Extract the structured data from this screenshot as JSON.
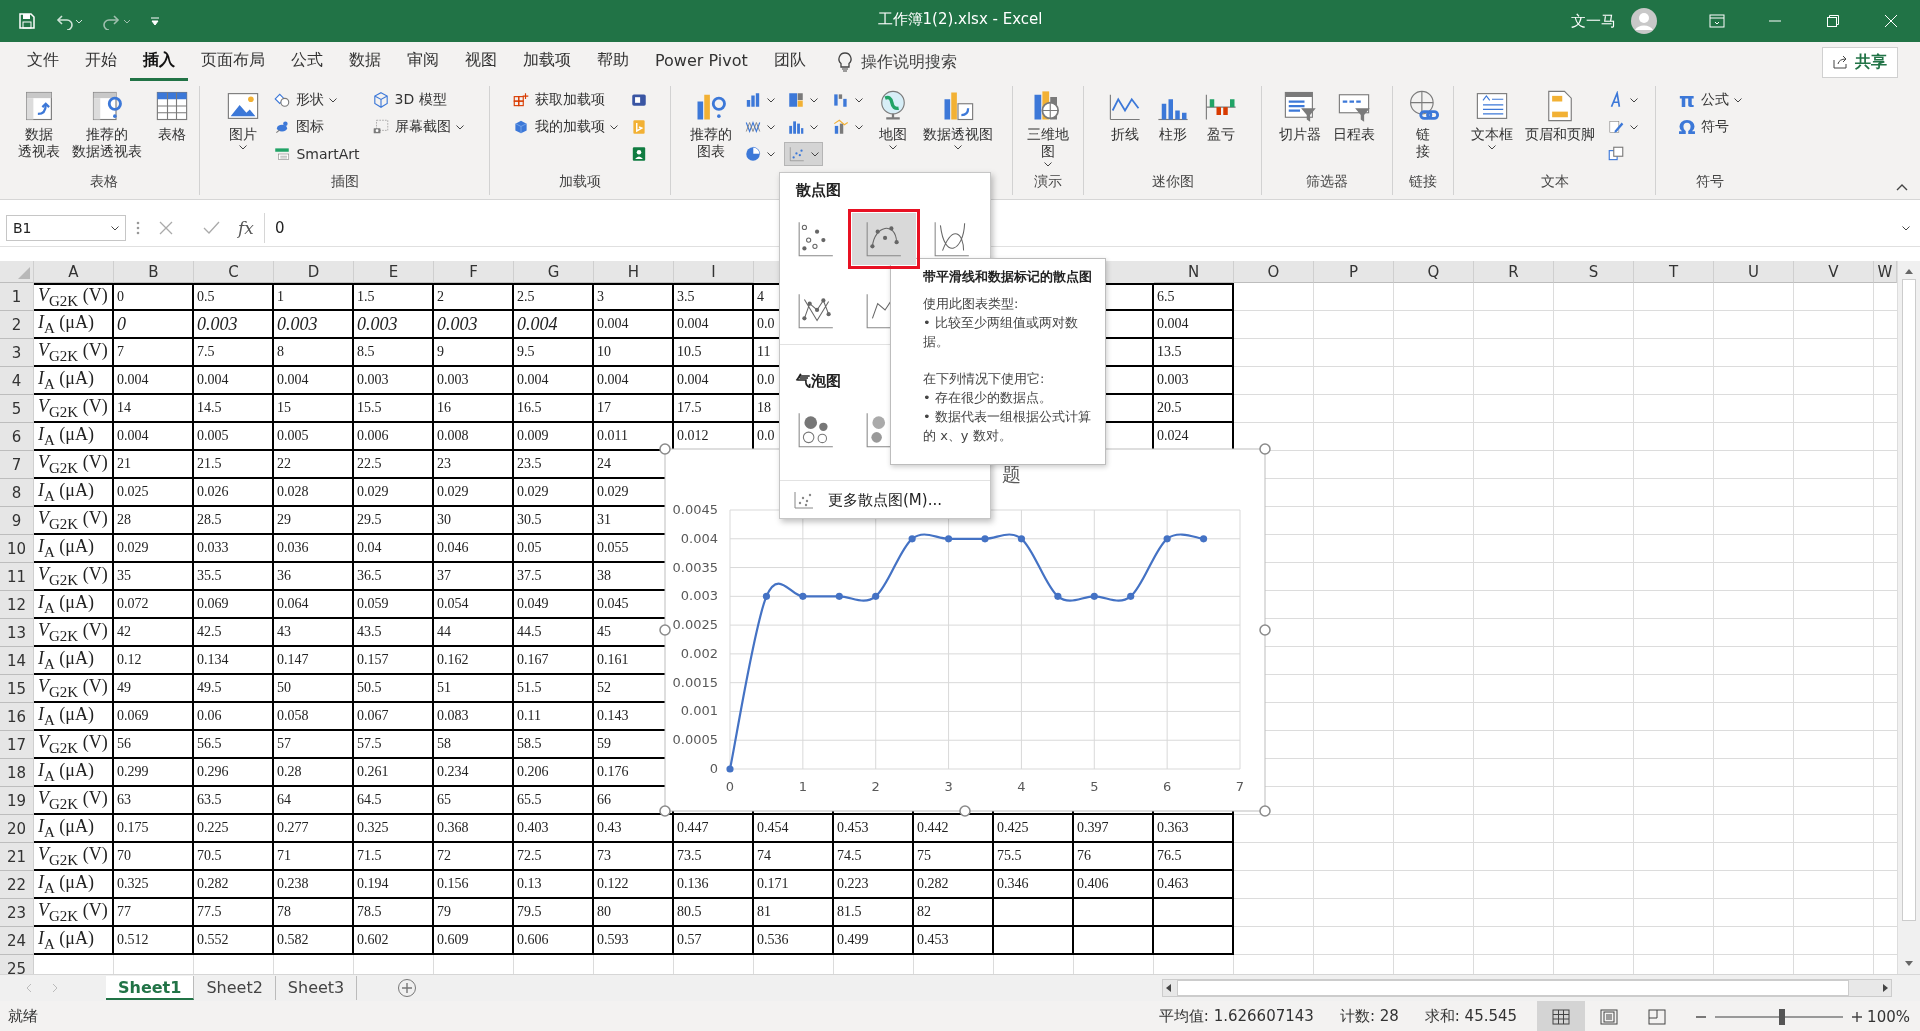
{
  "window": {
    "title": "工作簿1(2).xlsx - Excel",
    "user": "文一马"
  },
  "menu_tabs": [
    {
      "label": "文件",
      "selected": false
    },
    {
      "label": "开始",
      "selected": false
    },
    {
      "label": "插入",
      "selected": true
    },
    {
      "label": "页面布局",
      "selected": false
    },
    {
      "label": "公式",
      "selected": false
    },
    {
      "label": "数据",
      "selected": false
    },
    {
      "label": "审阅",
      "selected": false
    },
    {
      "label": "视图",
      "selected": false
    },
    {
      "label": "加载项",
      "selected": false
    },
    {
      "label": "帮助",
      "selected": false
    },
    {
      "label": "Power Pivot",
      "selected": false
    },
    {
      "label": "团队",
      "selected": false
    }
  ],
  "tell_me": {
    "placeholder": "操作说明搜索"
  },
  "share": "共享",
  "ribbon": [
    {
      "label": "表格",
      "items": [
        {
          "kind": "large",
          "lines": [
            "数据",
            "透视表"
          ]
        },
        {
          "kind": "large",
          "lines": [
            "推荐的",
            "数据透视表"
          ]
        },
        {
          "kind": "large",
          "lines": [
            "表格"
          ]
        }
      ]
    },
    {
      "label": "插图",
      "items": [
        {
          "kind": "large",
          "lines": [
            "图片"
          ],
          "dropdown": true
        },
        {
          "kind": "stack",
          "rows": [
            {
              "label": "形状",
              "dropdown": true
            },
            {
              "label": "图标"
            },
            {
              "label": "SmartArt"
            }
          ]
        },
        {
          "kind": "stack",
          "rows": [
            {
              "label": "3D 模型"
            },
            {
              "label": "屏幕截图",
              "dropdown": true
            }
          ]
        }
      ]
    },
    {
      "label": "加载项",
      "items": [
        {
          "kind": "stack",
          "rows": [
            {
              "label": "获取加载项"
            },
            {
              "label": "我的加载项",
              "dropdown": true
            }
          ]
        },
        {
          "kind": "stack",
          "rows": [
            {
              "dropdown": false
            },
            {
              "dropdown": false
            },
            {
              "dropdown": false
            }
          ]
        }
      ]
    },
    {
      "items": [
        {
          "kind": "large",
          "lines": [
            "推荐的",
            "图表"
          ]
        },
        {
          "kind": "stack",
          "rows": [
            {
              "dropdown": true,
              "pressed": false
            },
            {
              "dropdown": true,
              "pressed": false
            },
            {
              "dropdown": true,
              "pressed": false
            }
          ]
        },
        {
          "kind": "stack",
          "rows": [
            {
              "dropdown": true,
              "pressed": false
            },
            {
              "dropdown": true,
              "pressed": false
            },
            {
              "dropdown": true,
              "pressed": true
            }
          ]
        },
        {
          "kind": "stack",
          "rows": [
            {
              "dropdown": true,
              "pressed": false
            },
            {
              "dropdown": true,
              "pressed": false
            }
          ]
        },
        {
          "kind": "large",
          "lines": [
            "地图"
          ],
          "dropdown": true
        },
        {
          "kind": "large",
          "lines": [
            "数据透视图"
          ],
          "dropdown": true
        }
      ]
    },
    {
      "label": "演示",
      "items": [
        {
          "kind": "large",
          "lines": [
            "三维地",
            "图"
          ],
          "dropdown": true
        }
      ]
    },
    {
      "label": "迷你图",
      "items": [
        {
          "kind": "large",
          "lines": [
            "折线"
          ]
        },
        {
          "kind": "large",
          "lines": [
            "柱形"
          ]
        },
        {
          "kind": "large",
          "lines": [
            "盈亏"
          ]
        }
      ]
    },
    {
      "label": "筛选器",
      "items": [
        {
          "kind": "large",
          "lines": [
            "切片器"
          ]
        },
        {
          "kind": "large",
          "lines": [
            "日程表"
          ]
        }
      ]
    },
    {
      "label": "链接",
      "items": [
        {
          "kind": "large",
          "lines": [
            "链",
            "接"
          ]
        }
      ]
    },
    {
      "label": "文本",
      "items": [
        {
          "kind": "large",
          "lines": [
            "文本框"
          ],
          "dropdown": true
        },
        {
          "kind": "large",
          "lines": [
            "页眉和页脚"
          ]
        },
        {
          "kind": "stack",
          "rows": [
            {
              "dropdown": true
            },
            {
              "dropdown": true
            },
            {
              "dropdown": false
            }
          ]
        }
      ]
    },
    {
      "label": "符号",
      "items": [
        {
          "kind": "stack",
          "rows": [
            {
              "symbol": "π",
              "label": "公式",
              "dropdown": true
            },
            {
              "symbol": "Ω",
              "label": "符号"
            }
          ]
        }
      ]
    }
  ],
  "formula_bar": {
    "name_box": "B1",
    "function_label": "fx",
    "value": "0"
  },
  "sheet": {
    "columns": [
      "A",
      "B",
      "C",
      "D",
      "E",
      "F",
      "G",
      "H",
      "I"
    ],
    "columns_after": [
      "N",
      "O",
      "P",
      "Q",
      "R",
      "S",
      "T",
      "U",
      "V",
      "W"
    ],
    "rows": [
      {
        "number": "1",
        "label": "*V*$_{G2K}$ (V)",
        "cells": [
          "0",
          "0.5",
          "1",
          "1.5",
          "2",
          "2.5",
          "3",
          "3.5",
          "4"
        ],
        "cells_after": [
          "6.5"
        ]
      },
      {
        "number": "2",
        "label": "*I*$_{A}$ (μA)",
        "cells": [
          {
            "text": "0",
            "italic": true
          },
          {
            "text": "0.003",
            "italic": true
          },
          {
            "text": "0.003",
            "italic": true
          },
          {
            "text": "0.003",
            "italic": true
          },
          {
            "text": "0.003",
            "italic": true
          },
          {
            "text": "0.004",
            "italic": true
          },
          {
            "text": "0.004",
            "italic": false
          },
          {
            "text": "0.004",
            "italic": false
          },
          {
            "text": "0.0",
            "italic": false
          }
        ],
        "cells_after": [
          "0.004"
        ]
      },
      {
        "number": "3",
        "label": "*V*$_{G2K}$ (V)",
        "cells": [
          "7",
          "7.5",
          "8",
          "8.5",
          "9",
          "9.5",
          "10",
          "10.5",
          "11"
        ],
        "cells_after": [
          "13.5"
        ]
      },
      {
        "number": "4",
        "label": "*I*$_{A}$ (μA)",
        "cells": [
          "0.004",
          "0.004",
          "0.004",
          "0.003",
          "0.003",
          "0.004",
          "0.004",
          "0.004",
          "0.0"
        ],
        "cells_after": [
          "0.003"
        ]
      },
      {
        "number": "5",
        "label": "*V*$_{G2K}$ (V)",
        "cells": [
          "14",
          "14.5",
          "15",
          "15.5",
          "16",
          "16.5",
          "17",
          "17.5",
          "18"
        ],
        "cells_after": [
          "20.5"
        ]
      },
      {
        "number": "6",
        "label": "*I*$_{A}$ (μA)",
        "cells": [
          "0.004",
          "0.005",
          "0.005",
          "0.006",
          "0.008",
          "0.009",
          "0.011",
          "0.012",
          "0.0"
        ],
        "cells_after": [
          "0.024"
        ]
      },
      {
        "number": "7",
        "label": "*V*$_{G2K}$ (V)",
        "cells": [
          "21",
          "21.5",
          "22",
          "22.5",
          "23",
          "23.5",
          "24"
        ]
      },
      {
        "number": "8",
        "label": "*I*$_{A}$ (μA)",
        "cells": [
          "0.025",
          "0.026",
          "0.028",
          "0.029",
          "0.029",
          "0.029",
          "0.029"
        ]
      },
      {
        "number": "9",
        "label": "*V*$_{G2K}$ (V)",
        "cells": [
          "28",
          "28.5",
          "29",
          "29.5",
          "30",
          "30.5",
          "31"
        ]
      },
      {
        "number": "10",
        "label": "*I*$_{A}$ (μA)",
        "cells": [
          "0.029",
          "0.033",
          "0.036",
          "0.04",
          "0.046",
          "0.05",
          "0.055"
        ]
      },
      {
        "number": "11",
        "label": "*V*$_{G2K}$ (V)",
        "cells": [
          "35",
          "35.5",
          "36",
          "36.5",
          "37",
          "37.5",
          "38"
        ]
      },
      {
        "number": "12",
        "label": "*I*$_{A}$ (μA)",
        "cells": [
          "0.072",
          "0.069",
          "0.064",
          "0.059",
          "0.054",
          "0.049",
          "0.045"
        ]
      },
      {
        "number": "13",
        "label": "*V*$_{G2K}$ (V)",
        "cells": [
          "42",
          "42.5",
          "43",
          "43.5",
          "44",
          "44.5",
          "45"
        ]
      },
      {
        "number": "14",
        "label": "*I*$_{A}$ (μA)",
        "cells": [
          "0.12",
          "0.134",
          "0.147",
          "0.157",
          "0.162",
          "0.167",
          "0.161"
        ]
      },
      {
        "number": "15",
        "label": "*V*$_{G2K}$ (V)",
        "cells": [
          "49",
          "49.5",
          "50",
          "50.5",
          "51",
          "51.5",
          "52"
        ]
      },
      {
        "number": "16",
        "label": "*I*$_{A}$ (μA)",
        "cells": [
          "0.069",
          "0.06",
          "0.058",
          "0.067",
          "0.083",
          "0.11",
          "0.143"
        ]
      },
      {
        "number": "17",
        "label": "*V*$_{G2K}$ (V)",
        "cells": [
          "56",
          "56.5",
          "57",
          "57.5",
          "58",
          "58.5",
          "59"
        ]
      },
      {
        "number": "18",
        "label": "*I*$_{A}$ (μA)",
        "cells": [
          "0.299",
          "0.296",
          "0.28",
          "0.261",
          "0.234",
          "0.206",
          "0.176"
        ]
      },
      {
        "number": "19",
        "label": "*V*$_{G2K}$ (V)",
        "cells": [
          "63",
          "63.5",
          "64",
          "64.5",
          "65",
          "65.5",
          "66"
        ]
      },
      {
        "number": "20",
        "label": "*I*$_{A}$ (μA)",
        "cells": [
          "0.175",
          "0.225",
          "0.277",
          "0.325",
          "0.368",
          "0.403",
          "0.43",
          "0.447",
          "0.454",
          "0.453",
          "0.442",
          "0.425",
          "0.397",
          "0.363"
        ]
      },
      {
        "number": "21",
        "label": "*V*$_{G2K}$ (V)",
        "cells": [
          "70",
          "70.5",
          "71",
          "71.5",
          "72",
          "72.5",
          "73",
          "73.5",
          "74",
          "74.5",
          "75",
          "75.5",
          "76",
          "76.5"
        ]
      },
      {
        "number": "22",
        "label": "*I*$_{A}$ (μA)",
        "cells": [
          "0.325",
          "0.282",
          "0.238",
          "0.194",
          "0.156",
          "0.13",
          "0.122",
          "0.136",
          "0.171",
          "0.223",
          "0.282",
          "0.346",
          "0.406",
          "0.463"
        ]
      },
      {
        "number": "23",
        "label": "*V*$_{G2K}$ (V)",
        "cells": [
          "77",
          "77.5",
          "78",
          "78.5",
          "79",
          "79.5",
          "80",
          "80.5",
          "81",
          "81.5",
          "82"
        ]
      },
      {
        "number": "24",
        "label": "*I*$_{A}$ (μA)",
        "cells": [
          "0.512",
          "0.552",
          "0.582",
          "0.602",
          "0.609",
          "0.606",
          "0.593",
          "0.57",
          "0.536",
          "0.499",
          "0.453"
        ]
      },
      {
        "number": "25"
      }
    ]
  },
  "chart": {
    "chart_data": {
      "type": "line",
      "title": "题",
      "x": [
        0,
        0.5,
        1,
        1.5,
        2,
        2.5,
        3,
        3.5,
        4,
        4.5,
        5,
        5.5,
        6,
        6.5
      ],
      "series": [
        {
          "color": "#4472c4",
          "marker": true,
          "values": [
            0,
            0.003,
            0.003,
            0.003,
            0.003,
            0.004,
            0.004,
            0.004,
            0.004,
            0.003,
            0.003,
            0.003,
            0.004,
            0.004
          ]
        }
      ],
      "grid": true,
      "xlim": [
        0,
        7
      ],
      "ylim": [
        0,
        0.0045
      ],
      "xticks": [
        0,
        1,
        2,
        3,
        4,
        5,
        6,
        7
      ],
      "yticks": [
        0,
        0.0005,
        0.001,
        0.0015,
        0.002,
        0.0025,
        0.003,
        0.0035,
        0.004,
        0.0045
      ]
    }
  },
  "chart_menu": {
    "sections": [
      {
        "title": "散点图",
        "items": [
          {
            "selected": false
          },
          {
            "selected": true
          },
          {
            "selected": false
          },
          {
            "selected": false
          },
          {
            "selected": false
          }
        ]
      },
      {
        "title": "气泡图",
        "items": [
          {
            "selected": false
          },
          {
            "selected": false
          }
        ]
      }
    ],
    "more": "更多散点图(M)..."
  },
  "tooltip": {
    "title": "带平滑线和数据标记的散点图",
    "sections": [
      {
        "heading": "使用此图表类型:",
        "bullets": [
          "• 比较至少两组值或两对数据。"
        ]
      },
      {
        "heading": "在下列情况下使用它:",
        "bullets": [
          "• 存在很少的数据点。",
          "• 数据代表一组根据公式计算的 x、y 数对。"
        ]
      }
    ]
  },
  "sheet_tabs": [
    {
      "label": "Sheet1",
      "selected": true
    },
    {
      "label": "Sheet2",
      "selected": false
    },
    {
      "label": "Sheet3",
      "selected": false
    }
  ],
  "status_bar": {
    "ready": "就绪",
    "stats": [
      "平均值: 1.626607143",
      "计数: 28",
      "求和: 45.545"
    ],
    "views": [
      {
        "selected": true
      },
      {
        "selected": false
      },
      {
        "selected": false
      }
    ],
    "zoom": {
      "level": 0.5,
      "reading": "100%"
    }
  }
}
